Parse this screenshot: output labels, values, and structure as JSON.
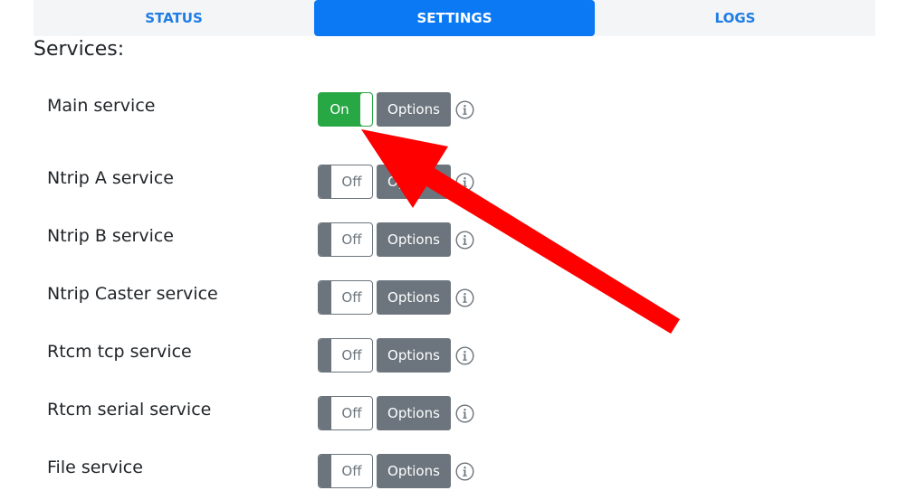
{
  "tabs": [
    {
      "label": "STATUS",
      "active": false
    },
    {
      "label": "SETTINGS",
      "active": true
    },
    {
      "label": "LOGS",
      "active": false
    }
  ],
  "section_title": "Services:",
  "services": [
    {
      "label": "Main service",
      "state": "On",
      "options_label": "Options"
    },
    {
      "label": "Ntrip A service",
      "state": "Off",
      "options_label": "Options"
    },
    {
      "label": "Ntrip B service",
      "state": "Off",
      "options_label": "Options"
    },
    {
      "label": "Ntrip Caster service",
      "state": "Off",
      "options_label": "Options"
    },
    {
      "label": "Rtcm tcp service",
      "state": "Off",
      "options_label": "Options"
    },
    {
      "label": "Rtcm serial service",
      "state": "Off",
      "options_label": "Options"
    },
    {
      "label": "File service",
      "state": "Off",
      "options_label": "Options"
    }
  ],
  "colors": {
    "active_tab": "#0b79f4",
    "tab_text": "#1f7de6",
    "toggle_on": "#28a745",
    "secondary": "#6c757d",
    "annotation_arrow": "#ff0000"
  },
  "icons": {
    "info": "info-circle-icon"
  }
}
